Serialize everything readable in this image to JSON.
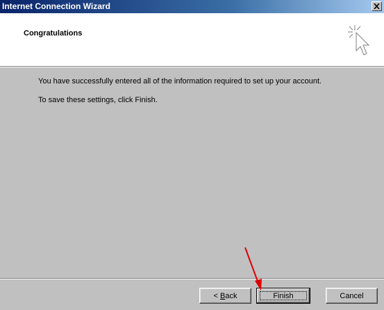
{
  "window": {
    "title": "Internet Connection Wizard"
  },
  "header": {
    "title": "Congratulations",
    "icon": "wizard-cursor-icon"
  },
  "body": {
    "line1": "You have successfully entered all of the information required to set up your account.",
    "line2": "To save these settings, click Finish."
  },
  "buttons": {
    "back_prefix": "< ",
    "back_mnemonic": "B",
    "back_rest": "ack",
    "finish": "Finish",
    "cancel": "Cancel"
  },
  "annotation": {
    "arrow_color": "#e00000"
  },
  "colors": {
    "dialog_bg": "#c0c0c0",
    "titlebar_start": "#0a246a",
    "titlebar_end": "#a6caf0"
  }
}
